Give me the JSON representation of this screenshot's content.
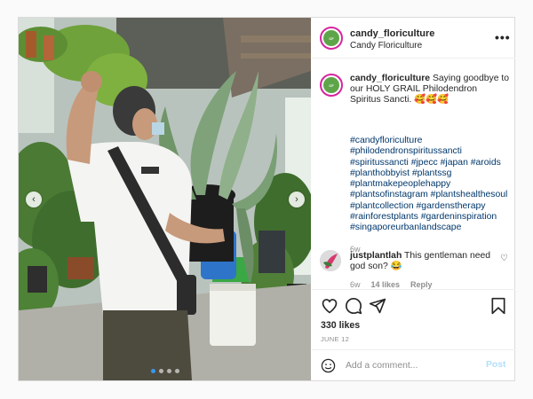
{
  "post": {
    "username": "candy_floriculture",
    "subtitle": "Candy Floriculture",
    "more_icon": "more-horizontal-icon",
    "caption_username": "candy_floriculture",
    "caption_text": " Saying goodbye to our HOLY GRAIL Philodendron Spiritus Sancti. 🥰🥰🥰",
    "hashtags": "#candyfloriculture #philodendronspiritussancti #spiritussancti #jpecc #japan #aroids #planthobbyist #plantssg #plantmakepeoplehappy #plantsofinstagram #plantshealthesoul #plantcollection #gardenstherapy #rainforestplants #gardeninspiration #singaporeurbanlandscape",
    "caption_time": "6w"
  },
  "comment": {
    "username": "justplantlah",
    "text": " This gentleman need god son? 😂",
    "time": "6w",
    "likes": "14 likes",
    "reply": "Reply"
  },
  "actions": {
    "likes_count": "330 likes",
    "date": "JUNE 12"
  },
  "add_comment": {
    "placeholder": "Add a comment...",
    "post_label": "Post"
  },
  "carousel": {
    "slides": 4,
    "active_index": 0
  },
  "colors": {
    "link": "#00376b",
    "post_button": "#b2dffc",
    "avatar_ring": "#d6249f",
    "carousel_active_dot": "#3897f0"
  }
}
